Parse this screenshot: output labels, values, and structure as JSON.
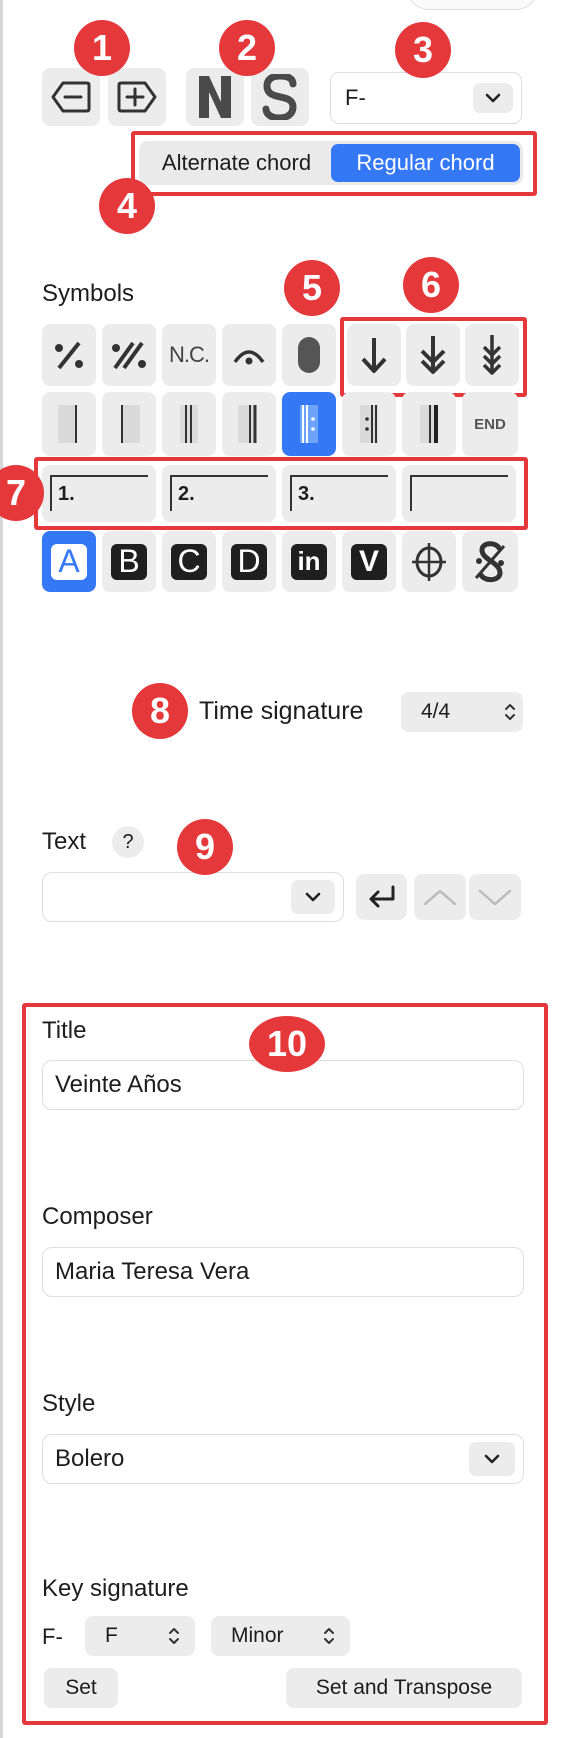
{
  "annotations": {
    "n1": "1",
    "n2": "2",
    "n3": "3",
    "n4": "4",
    "n5": "5",
    "n6": "6",
    "n7": "7",
    "n8": "8",
    "n9": "9",
    "n10": "10"
  },
  "chord_quality": {
    "value": "F-"
  },
  "chord_mode": {
    "options": [
      "Alternate chord",
      "Regular chord"
    ],
    "selected": "Regular chord"
  },
  "symbols": {
    "label": "Symbols",
    "nc_label": "N.C.",
    "end_label": "END",
    "endings": [
      "1.",
      "2.",
      "3.",
      ""
    ],
    "rehearsal_marks": [
      "A",
      "B",
      "C",
      "D",
      "in",
      "V"
    ],
    "selected_rehearsal": "A",
    "accent": "#3478f6",
    "annotation_color": "#e5383b",
    "icons": [
      "repeat-one-bar-icon",
      "repeat-two-bars-icon",
      "fermata-icon",
      "pause-icon",
      "single-down-arrow-icon",
      "double-down-arrow-icon",
      "triple-down-arrow-icon",
      "coda-icon",
      "segno-icon"
    ]
  },
  "time_signature": {
    "label": "Time signature",
    "value": "4/4"
  },
  "text": {
    "label": "Text",
    "help": "?",
    "value": ""
  },
  "song": {
    "title_label": "Title",
    "title": "Veinte Años",
    "composer_label": "Composer",
    "composer": "Maria Teresa Vera",
    "style_label": "Style",
    "style": "Bolero",
    "key_label": "Key signature",
    "key_current": "F-",
    "key_root": "F",
    "key_mode": "Minor",
    "set_label": "Set",
    "set_transpose_label": "Set and Transpose"
  }
}
